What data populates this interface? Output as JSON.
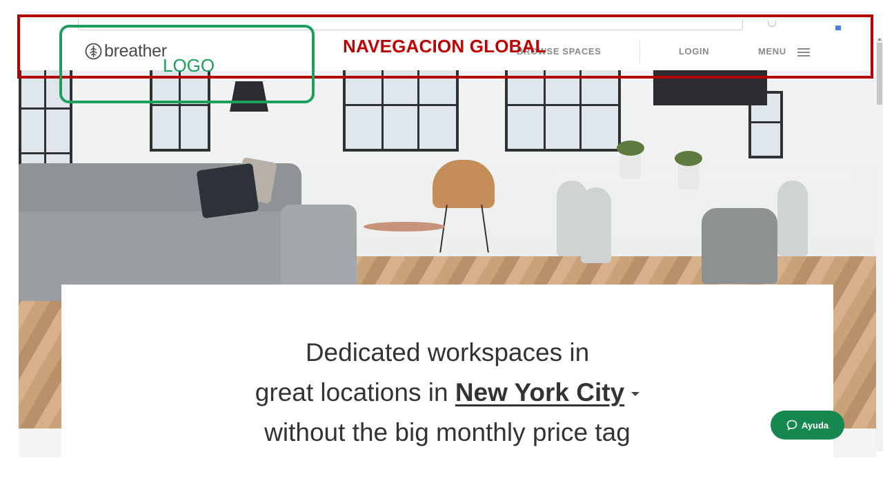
{
  "navbar": {
    "logo_text": "breather",
    "links": [
      {
        "label": "BROWSE SPACES"
      },
      {
        "label": "LOGIN"
      },
      {
        "label": "MENU"
      }
    ]
  },
  "hero": {
    "headline_line1": "Dedicated workspaces in",
    "headline_line2_prefix": "great locations in ",
    "city": "New York City",
    "headline_line3": "without the big monthly price tag"
  },
  "help": {
    "label": "Ayuda"
  },
  "annotations": {
    "global_nav": "NAVEGACION GLOBAL",
    "logo": "LOGO"
  },
  "colors": {
    "annotation_red": "#c00000",
    "annotation_green": "#1aa05a",
    "help_button": "#16884f",
    "nav_text": "#8a8a8a"
  }
}
